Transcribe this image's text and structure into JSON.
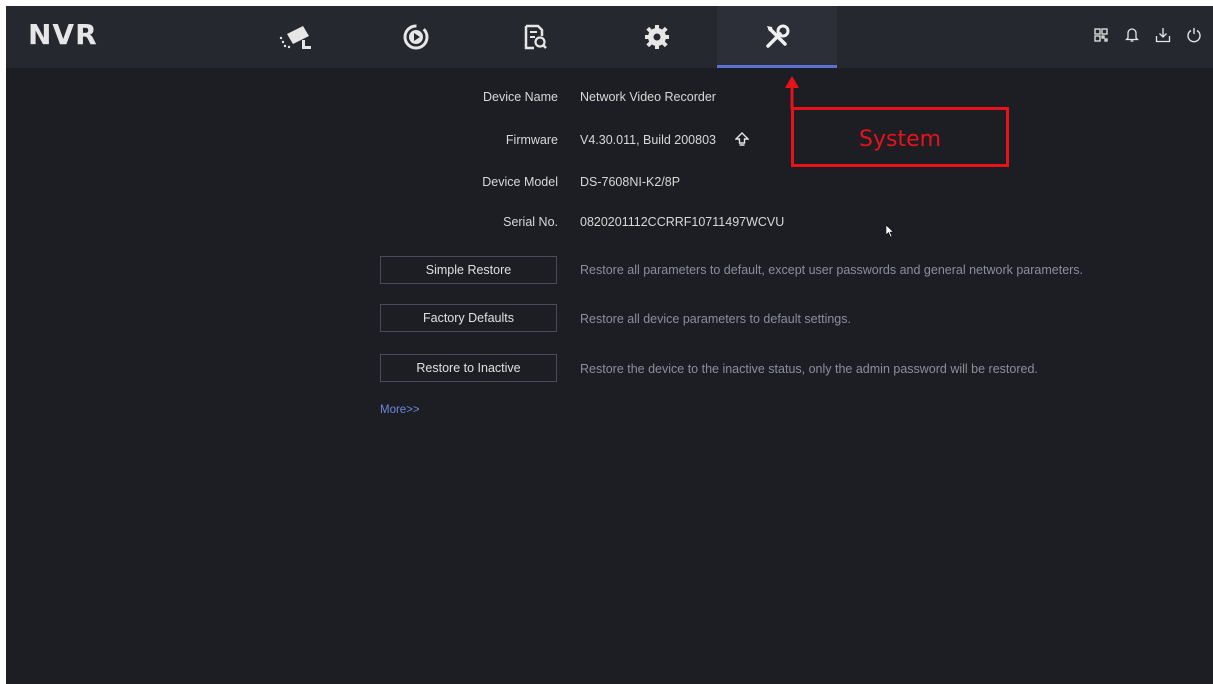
{
  "app": {
    "logo": "NVR"
  },
  "tabs": [
    {
      "name": "camera",
      "icon": "camera-icon",
      "active": false
    },
    {
      "name": "playback",
      "icon": "playback-icon",
      "active": false
    },
    {
      "name": "search",
      "icon": "file-search-icon",
      "active": false
    },
    {
      "name": "configuration",
      "icon": "gear-icon",
      "active": false
    },
    {
      "name": "maintenance",
      "icon": "tools-icon",
      "active": true
    }
  ],
  "header_icons": [
    "qr-code-icon",
    "bell-icon",
    "download-icon",
    "power-icon"
  ],
  "device_info": {
    "device_name_label": "Device Name",
    "device_name_value": "Network Video Recorder",
    "firmware_label": "Firmware",
    "firmware_value": "V4.30.011, Build 200803",
    "device_model_label": "Device Model",
    "device_model_value": "DS-7608NI-K2/8P",
    "serial_label": "Serial No.",
    "serial_value": "0820201112CCRRF10711497WCVU"
  },
  "actions": {
    "simple_restore_label": "Simple Restore",
    "simple_restore_desc": "Restore all parameters to default, except user passwords and general network parameters.",
    "factory_defaults_label": "Factory Defaults",
    "factory_defaults_desc": "Restore all device parameters to default settings.",
    "restore_inactive_label": "Restore to Inactive",
    "restore_inactive_desc": "Restore the device to the inactive status, only the admin password will be restored.",
    "more_link": "More>>"
  },
  "annotation": {
    "label": "System",
    "color": "#e8121b"
  },
  "colors": {
    "background": "#1c1e23",
    "topbar": "#262830",
    "accent": "#5b6fd6",
    "link": "#6f86e0"
  }
}
